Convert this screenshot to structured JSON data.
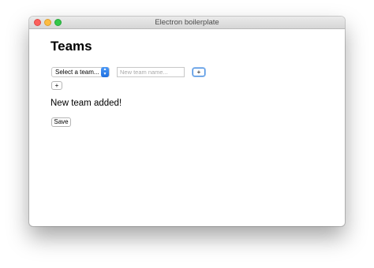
{
  "window": {
    "title": "Electron boilerplate"
  },
  "page": {
    "title": "Teams"
  },
  "team_select": {
    "selected": "Select a team...",
    "arrow_glyph": "▲▼"
  },
  "new_team_input": {
    "value": "",
    "placeholder": "New team name..."
  },
  "add_button_primary": {
    "label": "+"
  },
  "add_button_secondary": {
    "label": "+"
  },
  "status": {
    "message": "New team added!"
  },
  "save_button": {
    "label": "Save"
  },
  "colors": {
    "close": "#fc605c",
    "minimize": "#fdbc40",
    "maximize": "#34c84a",
    "select_accent": "#1e6fe0",
    "focus_ring": "#4a90e2"
  }
}
